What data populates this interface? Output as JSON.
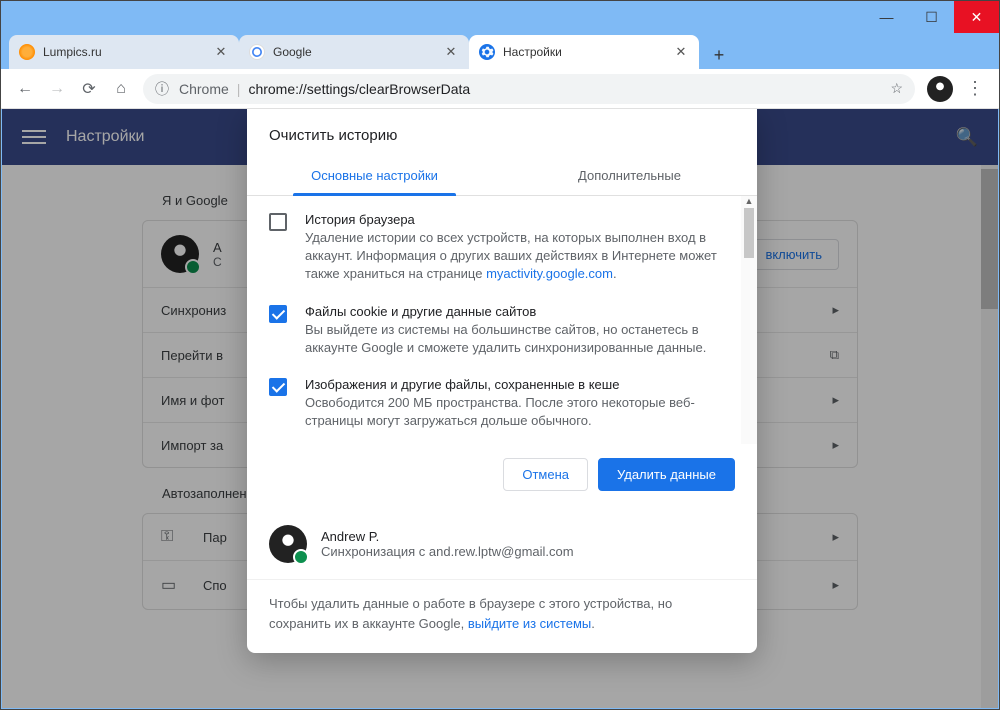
{
  "tabs": {
    "t0": "Lumpics.ru",
    "t1": "Google",
    "t2": "Настройки"
  },
  "addr": {
    "chrome_label": "Chrome",
    "url": "chrome://settings/clearBrowserData"
  },
  "settings": {
    "title": "Настройки",
    "section_me": "Я и Google",
    "section_autofill": "Автозаполнение",
    "account_name": "A",
    "account_sub": "С",
    "enable_btn": "включить",
    "rows": {
      "sync": "Синхрониз",
      "goto": "Перейти в",
      "name": "Имя и фот",
      "import": "Импорт за",
      "passwords": "Пар",
      "payment": "Спо"
    }
  },
  "dialog": {
    "title": "Очистить историю",
    "tab_basic": "Основные настройки",
    "tab_advanced": "Дополнительные",
    "opt_history_title": "История браузера",
    "opt_history_desc_a": "Удаление истории со всех устройств, на которых выполнен вход в аккаунт. Информация о других ваших действиях в Интернете может также храниться на странице ",
    "opt_history_link": "myactivity.google.com",
    "opt_cookies_title": "Файлы cookie и другие данные сайтов",
    "opt_cookies_desc": "Вы выйдете из системы на большинстве сайтов, но останетесь в аккаунте Google и сможете удалить синхронизированные данные.",
    "opt_cache_title": "Изображения и другие файлы, сохраненные в кеше",
    "opt_cache_desc": "Освободится 200 МБ пространства. После этого некоторые веб-страницы могут загружаться дольше обычного.",
    "cancel": "Отмена",
    "confirm": "Удалить данные",
    "sync_name": "Andrew P.",
    "sync_sub": "Синхронизация с and.rew.lptw@gmail.com",
    "sync_note_a": "Чтобы удалить данные о работе в браузере с этого устройства, но сохранить их в аккаунте Google, ",
    "sync_note_link": "выйдите из системы"
  }
}
